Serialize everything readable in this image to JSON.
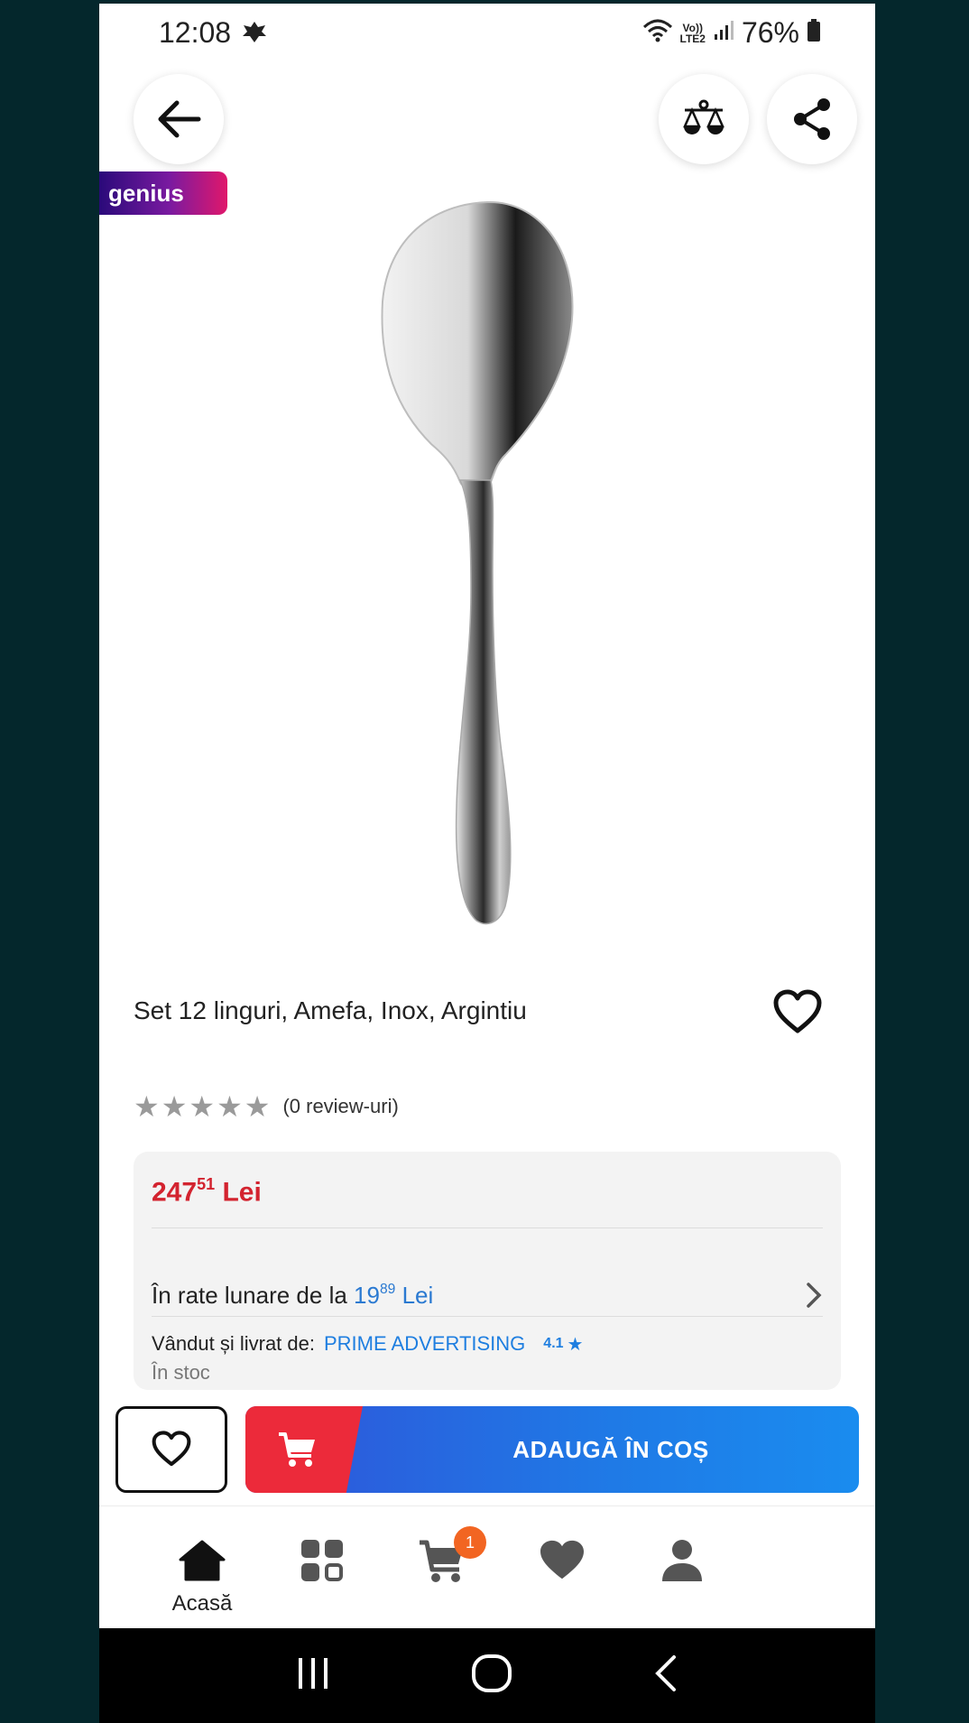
{
  "status_bar": {
    "time": "12:08",
    "network_top": "Vo))",
    "network_bottom": "LTE2",
    "battery": "76%"
  },
  "header": {
    "back_icon": "arrow-left-icon",
    "compare_icon": "scale-icon",
    "share_icon": "share-icon"
  },
  "badge": {
    "label": "genius"
  },
  "product": {
    "title": "Set 12 linguri, Amefa, Inox, Argintiu",
    "image": "spoon",
    "rating": {
      "stars": 0,
      "max": 5,
      "reviews_text": "(0 review-uri)"
    }
  },
  "price": {
    "integer": "247",
    "decimals": "51",
    "currency": "Lei"
  },
  "installments": {
    "prefix": "În rate lunare de la",
    "integer": "19",
    "decimals": "89",
    "currency": "Lei"
  },
  "seller": {
    "prefix": "Vândut și livrat de:",
    "name": "PRIME ADVERTISING",
    "score": "4.1",
    "stock": "În stoc"
  },
  "actions": {
    "add_to_cart": "ADAUGĂ ÎN COȘ"
  },
  "bottom_nav": {
    "items": [
      {
        "label": "Acasă",
        "icon": "home-icon"
      },
      {
        "label": "",
        "icon": "categories-icon"
      },
      {
        "label": "",
        "icon": "cart-icon",
        "badge": "1"
      },
      {
        "label": "",
        "icon": "heart-icon"
      },
      {
        "label": "",
        "icon": "account-icon"
      }
    ]
  },
  "colors": {
    "price_red": "#d3232f",
    "link_blue": "#1e7ee0",
    "cart_red": "#ec2a3a",
    "cart_blue": "#1f7ae6",
    "badge_orange": "#f26522"
  }
}
